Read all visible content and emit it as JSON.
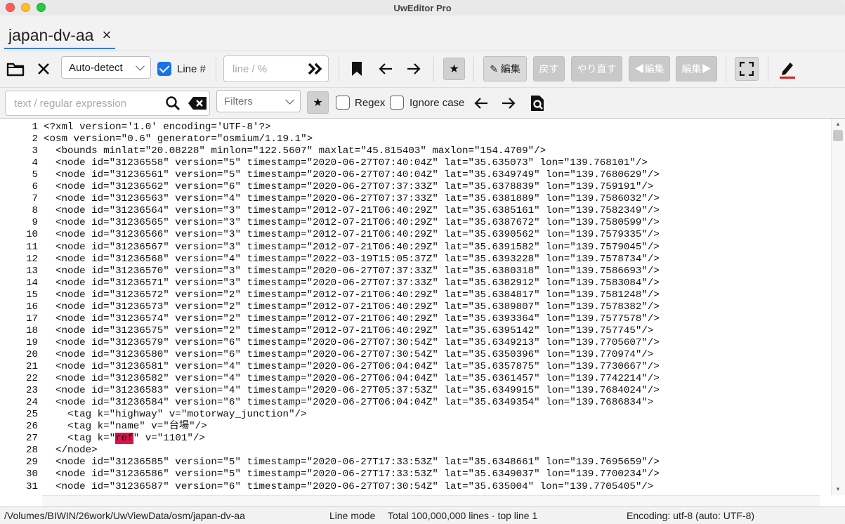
{
  "window": {
    "title": "UwEditor Pro"
  },
  "tab": {
    "label": "japan-dv-aa",
    "close": "×"
  },
  "toolbar": {
    "encoding_select": "Auto-detect",
    "line_numbers_label": "Line #",
    "line_numbers_checked": true,
    "goto_placeholder": "line / %",
    "goto_arrow": "»",
    "star": "★",
    "edit_label": "✎ 編集",
    "undo_label": "戻す",
    "redo_label": "やり直す",
    "prev_edit_label": "◀編集",
    "next_edit_label": "編集▶"
  },
  "search": {
    "placeholder": "text / regular expression",
    "filters_label": "Filters",
    "star": "★",
    "regex_label": "Regex",
    "regex_checked": false,
    "ignore_case_label": "Ignore case",
    "ignore_case_checked": false
  },
  "editor": {
    "lines": [
      {
        "n": "1",
        "t": "<?xml version='1.0' encoding='UTF-8'?>"
      },
      {
        "n": "2",
        "t": "<osm version=\"0.6\" generator=\"osmium/1.19.1\">"
      },
      {
        "n": "3",
        "t": "  <bounds minlat=\"20.08228\" minlon=\"122.5607\" maxlat=\"45.815403\" maxlon=\"154.4709\"/>"
      },
      {
        "n": "4",
        "t": "  <node id=\"31236558\" version=\"5\" timestamp=\"2020-06-27T07:40:04Z\" lat=\"35.635073\" lon=\"139.768101\"/>"
      },
      {
        "n": "5",
        "t": "  <node id=\"31236561\" version=\"5\" timestamp=\"2020-06-27T07:40:04Z\" lat=\"35.6349749\" lon=\"139.7680629\"/>"
      },
      {
        "n": "6",
        "t": "  <node id=\"31236562\" version=\"6\" timestamp=\"2020-06-27T07:37:33Z\" lat=\"35.6378839\" lon=\"139.759191\"/>"
      },
      {
        "n": "7",
        "t": "  <node id=\"31236563\" version=\"4\" timestamp=\"2020-06-27T07:37:33Z\" lat=\"35.6381889\" lon=\"139.7586032\"/>"
      },
      {
        "n": "8",
        "t": "  <node id=\"31236564\" version=\"3\" timestamp=\"2012-07-21T06:40:29Z\" lat=\"35.6385161\" lon=\"139.7582349\"/>"
      },
      {
        "n": "9",
        "t": "  <node id=\"31236565\" version=\"3\" timestamp=\"2012-07-21T06:40:29Z\" lat=\"35.6387672\" lon=\"139.7580599\"/>"
      },
      {
        "n": "10",
        "t": "  <node id=\"31236566\" version=\"3\" timestamp=\"2012-07-21T06:40:29Z\" lat=\"35.6390562\" lon=\"139.7579335\"/>"
      },
      {
        "n": "11",
        "t": "  <node id=\"31236567\" version=\"3\" timestamp=\"2012-07-21T06:40:29Z\" lat=\"35.6391582\" lon=\"139.7579045\"/>"
      },
      {
        "n": "12",
        "t": "  <node id=\"31236568\" version=\"4\" timestamp=\"2022-03-19T15:05:37Z\" lat=\"35.6393228\" lon=\"139.7578734\"/>"
      },
      {
        "n": "13",
        "t": "  <node id=\"31236570\" version=\"3\" timestamp=\"2020-06-27T07:37:33Z\" lat=\"35.6380318\" lon=\"139.7586693\"/>"
      },
      {
        "n": "14",
        "t": "  <node id=\"31236571\" version=\"3\" timestamp=\"2020-06-27T07:37:33Z\" lat=\"35.6382912\" lon=\"139.7583084\"/>"
      },
      {
        "n": "15",
        "t": "  <node id=\"31236572\" version=\"2\" timestamp=\"2012-07-21T06:40:29Z\" lat=\"35.6384817\" lon=\"139.7581248\"/>"
      },
      {
        "n": "16",
        "t": "  <node id=\"31236573\" version=\"2\" timestamp=\"2012-07-21T06:40:29Z\" lat=\"35.6389807\" lon=\"139.7578382\"/>"
      },
      {
        "n": "17",
        "t": "  <node id=\"31236574\" version=\"2\" timestamp=\"2012-07-21T06:40:29Z\" lat=\"35.6393364\" lon=\"139.7577578\"/>"
      },
      {
        "n": "18",
        "t": "  <node id=\"31236575\" version=\"2\" timestamp=\"2012-07-21T06:40:29Z\" lat=\"35.6395142\" lon=\"139.757745\"/>"
      },
      {
        "n": "19",
        "t": "  <node id=\"31236579\" version=\"6\" timestamp=\"2020-06-27T07:30:54Z\" lat=\"35.6349213\" lon=\"139.7705607\"/>"
      },
      {
        "n": "20",
        "t": "  <node id=\"31236580\" version=\"6\" timestamp=\"2020-06-27T07:30:54Z\" lat=\"35.6350396\" lon=\"139.770974\"/>"
      },
      {
        "n": "21",
        "t": "  <node id=\"31236581\" version=\"4\" timestamp=\"2020-06-27T06:04:04Z\" lat=\"35.6357875\" lon=\"139.7730667\"/>"
      },
      {
        "n": "22",
        "t": "  <node id=\"31236582\" version=\"4\" timestamp=\"2020-06-27T06:04:04Z\" lat=\"35.6361457\" lon=\"139.7742214\"/>"
      },
      {
        "n": "23",
        "t": "  <node id=\"31236583\" version=\"4\" timestamp=\"2020-06-27T05:37:53Z\" lat=\"35.6349915\" lon=\"139.7684024\"/>"
      },
      {
        "n": "24",
        "t": "  <node id=\"31236584\" version=\"6\" timestamp=\"2020-06-27T06:04:04Z\" lat=\"35.6349354\" lon=\"139.7686834\">"
      },
      {
        "n": "25",
        "t": "    <tag k=\"highway\" v=\"motorway_junction\"/>"
      },
      {
        "n": "26",
        "t": "    <tag k=\"name\" v=\"台場\"/>"
      },
      {
        "n": "27",
        "t": "    <tag k=\"ref\" v=\"1101\"/>",
        "pre": "    <tag k=\"",
        "match": "ref",
        "post": "\" v=\"1101\"/>"
      },
      {
        "n": "28",
        "t": "  </node>"
      },
      {
        "n": "29",
        "t": "  <node id=\"31236585\" version=\"5\" timestamp=\"2020-06-27T17:33:53Z\" lat=\"35.6348661\" lon=\"139.7695659\"/>"
      },
      {
        "n": "30",
        "t": "  <node id=\"31236586\" version=\"5\" timestamp=\"2020-06-27T17:33:53Z\" lat=\"35.6349037\" lon=\"139.7700234\"/>"
      },
      {
        "n": "31",
        "t": "  <node id=\"31236587\" version=\"6\" timestamp=\"2020-06-27T07:30:54Z\" lat=\"35.635004\" lon=\"139.7705405\"/>"
      }
    ]
  },
  "status": {
    "path": "/Volumes/BIWIN/26work/UwViewData/osm/japan-dv-aa",
    "mode": "Line mode",
    "total": "Total 100,000,000 lines · top line 1",
    "encoding": "Encoding: utf-8 (auto: UTF-8)"
  }
}
